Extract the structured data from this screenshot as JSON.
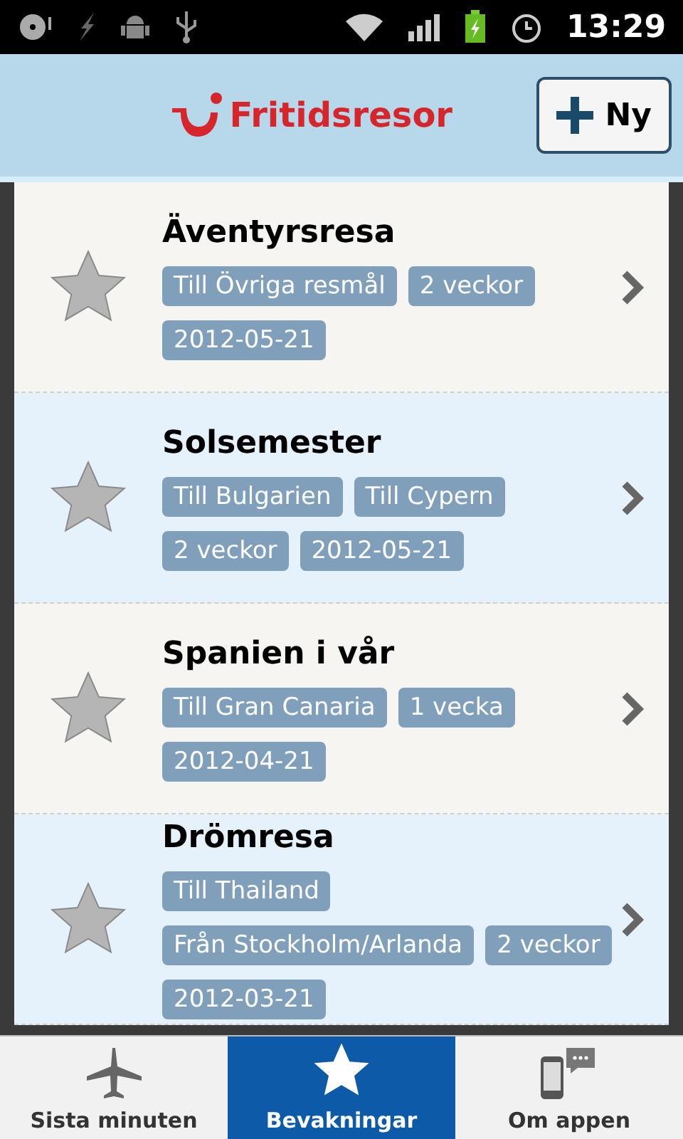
{
  "status_bar": {
    "time": "13:29"
  },
  "header": {
    "logo_text": "Fritidsresor",
    "new_button": "Ny"
  },
  "trips": [
    {
      "title": "Äventyrsresa",
      "tags": [
        "Till Övriga resmål",
        "2 veckor",
        "2012-05-21"
      ]
    },
    {
      "title": "Solsemester",
      "tags": [
        "Till Bulgarien",
        "Till Cypern",
        "2 veckor",
        "2012-05-21"
      ]
    },
    {
      "title": "Spanien i vår",
      "tags": [
        "Till Gran Canaria",
        "1 vecka",
        "2012-04-21"
      ]
    },
    {
      "title": "Drömresa",
      "tags": [
        "Till Thailand",
        "Från Stockholm/Arlanda",
        "2 veckor",
        "2012-03-21"
      ]
    }
  ],
  "tabs": [
    {
      "label": "Sista minuten",
      "kind": "plane",
      "selected": false
    },
    {
      "label": "Bevakningar",
      "kind": "star",
      "selected": true
    },
    {
      "label": "Om appen",
      "kind": "phone",
      "selected": false
    }
  ]
}
